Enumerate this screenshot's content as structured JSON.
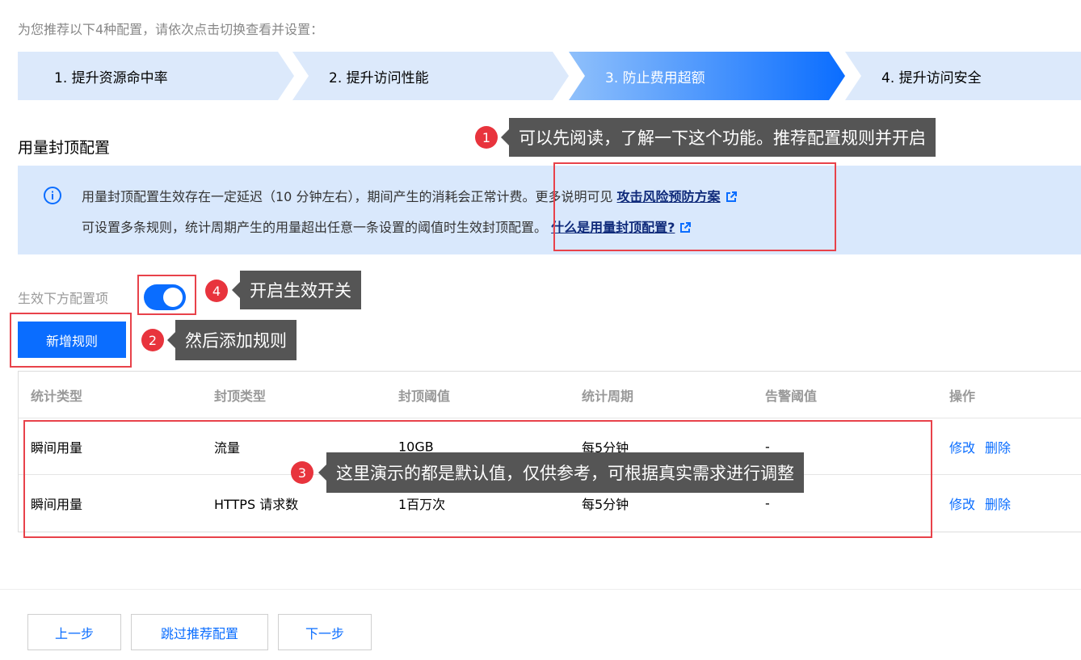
{
  "intro": "为您推荐以下4种配置，请依次点击切换查看并设置：",
  "steps": [
    {
      "label": "1. 提升资源命中率"
    },
    {
      "label": "2. 提升访问性能"
    },
    {
      "label": "3. 防止费用超额"
    },
    {
      "label": "4. 提升访问安全"
    }
  ],
  "section_title": "用量封顶配置",
  "info": {
    "line1_text": "用量封顶配置生效存在一定延迟（10 分钟左右），期间产生的消耗会正常计费。更多说明可见",
    "line1_link": "攻击风险预防方案",
    "line2_text": "可设置多条规则，统计周期产生的用量超出任意一条设置的阈值时生效封顶配置。",
    "line2_link": "什么是用量封顶配置?"
  },
  "toggle": {
    "label": "生效下方配置项",
    "on": true
  },
  "add_button": "新增规则",
  "table": {
    "headers": [
      "统计类型",
      "封顶类型",
      "封顶阈值",
      "统计周期",
      "告警阈值",
      "操作"
    ],
    "rows": [
      {
        "stat_type": "瞬间用量",
        "cap_type": "流量",
        "threshold": "10GB",
        "period": "每5分钟",
        "alert": "-",
        "edit": "修改",
        "delete": "删除"
      },
      {
        "stat_type": "瞬间用量",
        "cap_type": "HTTPS 请求数",
        "threshold": "1百万次",
        "period": "每5分钟",
        "alert": "-",
        "edit": "修改",
        "delete": "删除"
      }
    ]
  },
  "footer": {
    "prev": "上一步",
    "skip": "跳过推荐配置",
    "next": "下一步"
  },
  "annotations": [
    {
      "number": "1",
      "text": "可以先阅读，了解一下这个功能。推荐配置规则并开启"
    },
    {
      "number": "2",
      "text": "然后添加规则"
    },
    {
      "number": "3",
      "text": "这里演示的都是默认值，仅供参考，可根据真实需求进行调整"
    },
    {
      "number": "4",
      "text": "开启生效开关"
    }
  ],
  "colors": {
    "primary": "#0a6dff",
    "step_bg": "#dce9fb",
    "info_bg": "#d9e8fc",
    "annotation_red": "#e8424a",
    "callout_bg": "#555555"
  }
}
